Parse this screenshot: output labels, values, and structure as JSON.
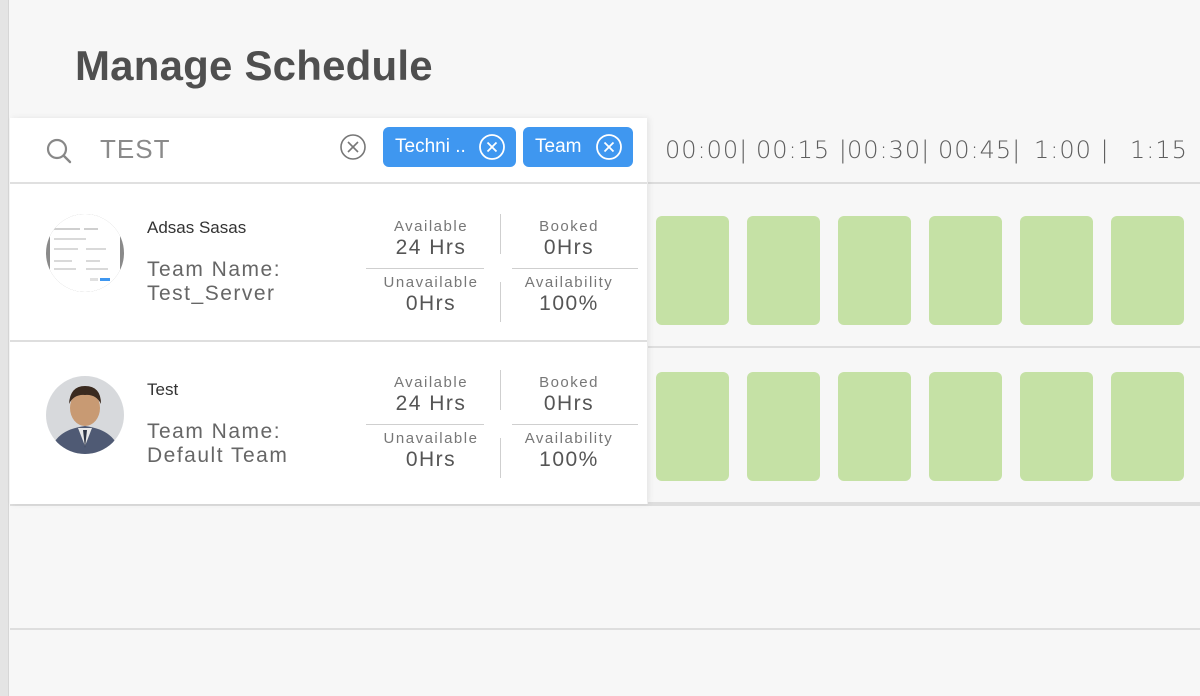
{
  "page": {
    "title": "Manage Schedule"
  },
  "search": {
    "value": "TEST",
    "placeholder": ""
  },
  "filters": [
    {
      "label": "Techni .."
    },
    {
      "label": "Team"
    }
  ],
  "timeline": {
    "ticks": [
      "00:00|",
      "00:15 |",
      "00:30|",
      "00:45|",
      "1:00  |",
      "1:15  |"
    ]
  },
  "members": [
    {
      "name": "Adsas Sasas",
      "team_line1": "Team Name:",
      "team_line2": "Test_Server",
      "available_label": "Available",
      "available": "24 Hrs",
      "booked_label": "Booked",
      "booked": "0Hrs",
      "unavailable_label": "Unavailable",
      "unavailable": "0Hrs",
      "availability_label": "Availability",
      "availability": "100%"
    },
    {
      "name": "Test",
      "team_line1": "Team Name:",
      "team_line2": "Default Team",
      "available_label": "Available",
      "available": "24 Hrs",
      "booked_label": "Booked",
      "booked": "0Hrs",
      "unavailable_label": "Unavailable",
      "unavailable": "0Hrs",
      "availability_label": "Availability",
      "availability": "100%"
    }
  ],
  "colors": {
    "accent": "#3f97f0",
    "slot_available": "#c5e1a5",
    "title": "#4f4f4f"
  },
  "icons": {
    "search": "search-icon",
    "clear": "close-circle-icon"
  }
}
